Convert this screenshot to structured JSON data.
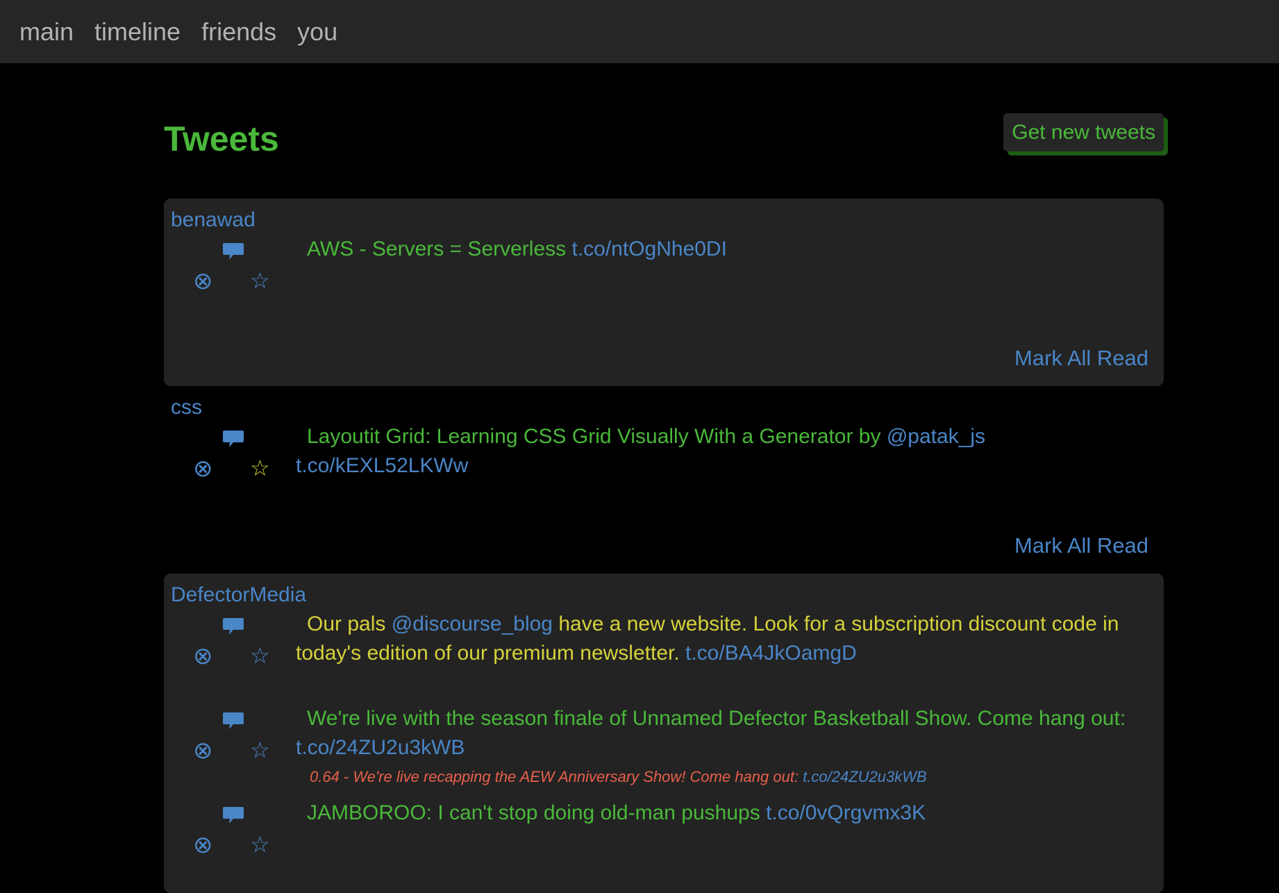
{
  "nav": {
    "items": [
      "main",
      "timeline",
      "friends",
      "you"
    ]
  },
  "header": {
    "title": "Tweets",
    "get_new_label": "Get new tweets"
  },
  "mark_all_read_label": "Mark All Read",
  "groups": [
    {
      "user": "benawad",
      "tweets": [
        {
          "text": "AWS - Servers = Serverless",
          "link": "t.co/ntOgNhe0DI",
          "favorited": false
        }
      ]
    },
    {
      "user": "css",
      "tweets": [
        {
          "text": "Layoutit Grid: Learning CSS Grid Visually With a Generator by",
          "mention": "@patak_js",
          "link": "t.co/kEXL52LKWw",
          "favorited": true
        }
      ]
    },
    {
      "user": "DefectorMedia",
      "tweets": [
        {
          "text_a": "Our pals",
          "mention": "@discourse_blog",
          "text_b": "have a new website. Look for a subscription discount code in today's edition of our premium newsletter.",
          "link": "t.co/BA4JkOamgD",
          "favorited": false,
          "color": "yellow"
        },
        {
          "text": "We're live with the season finale of Unnamed Defector Basketball Show. Come hang out:",
          "link": "t.co/24ZU2u3kWB",
          "favorited": false,
          "note": {
            "text": "0.64 - We're live recapping the AEW Anniversary Show! Come hang out:",
            "link": "t.co/24ZU2u3kWB"
          }
        },
        {
          "text": "JAMBOROO: I can't stop doing old-man pushups",
          "link": "t.co/0vQrgvmx3K",
          "favorited": false
        }
      ]
    }
  ],
  "icons": {
    "reply": "speech-bubble-icon",
    "dismiss": "circled-x-icon",
    "favorite": "star-icon"
  },
  "colors": {
    "background": "#000000",
    "panel": "#232323",
    "green_text": "#4ab83a",
    "link_blue": "#4a86c8",
    "yellow_text": "#d6d23a",
    "note_red": "#e8604a"
  }
}
